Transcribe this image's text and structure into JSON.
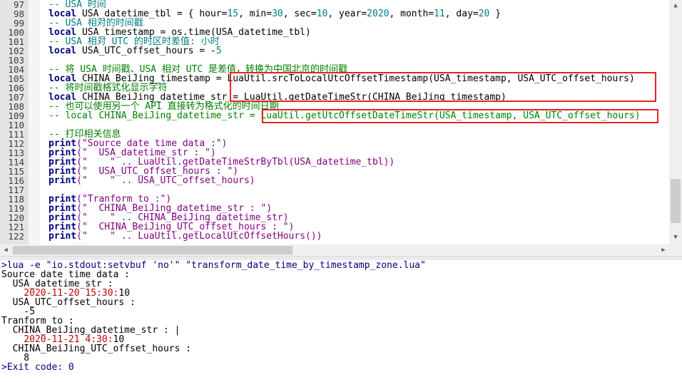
{
  "editor": {
    "lines": [
      {
        "n": "97"
      },
      {
        "n": "98"
      },
      {
        "n": "99"
      },
      {
        "n": "100"
      },
      {
        "n": "101"
      },
      {
        "n": "102"
      },
      {
        "n": "103"
      },
      {
        "n": "104"
      },
      {
        "n": "105"
      },
      {
        "n": "106"
      },
      {
        "n": "107"
      },
      {
        "n": "108"
      },
      {
        "n": "109"
      },
      {
        "n": "110"
      },
      {
        "n": "111"
      },
      {
        "n": "112"
      },
      {
        "n": "113"
      },
      {
        "n": "114"
      },
      {
        "n": "115"
      },
      {
        "n": "116"
      },
      {
        "n": "117"
      },
      {
        "n": "118"
      },
      {
        "n": "119"
      },
      {
        "n": "120"
      },
      {
        "n": "121"
      },
      {
        "n": "122"
      }
    ],
    "code": {
      "l97": "-- USA 时间",
      "l98_kw": "local",
      "l98_a": " USA_datetime_tbl = { hour=",
      "l98_n1": "15",
      "l98_b": ", min=",
      "l98_n2": "30",
      "l98_c": ", sec=",
      "l98_n3": "10",
      "l98_d": ", year=",
      "l98_n4": "2020",
      "l98_e": ", month=",
      "l98_n5": "11",
      "l98_f": ", day=",
      "l98_n6": "20",
      "l98_g": " }",
      "l99": "-- USA 相对的时间戳",
      "l100_kw": "local",
      "l100_a": " USA_timestamp = os.time(USA_datetime_tbl)",
      "l101": "-- USA 相对 UTC 的时区时差值: 小时",
      "l102_kw": "local",
      "l102_a": " USA_UTC_offset_hours = -",
      "l102_n": "5",
      "l104": "-- 将 USA 时间戳、USA 相对 UTC 是差值，转换为中国北京的时间戳",
      "l105_kw": "local",
      "l105_a": " CHINA_BeiJing_timestamp = LuaUtil.srcToLocalUtcOffsetTimestamp(USA_timestamp, USA_UTC_offset_hours)",
      "l106": "-- 将时间戳格式化显示字符",
      "l107_kw": "local",
      "l107_a": " CHINA_BeiJing_datetime_str = LuaUtil.getDateTimeStr(CHINA_BeiJing_timestamp)",
      "l108": "-- 也可以使用另一个 API 直接转为格式化的时间日期",
      "l109": "-- local CHINA_BeiJing_datetime_str = LuaUtil.getUtcOffsetDateTimeStr(USA_timestamp, USA_UTC_offset_hours)",
      "l111": "-- 打印相关信息",
      "print": "print",
      "l112_s": "(\"Source date time data :\")",
      "l113_s": "(\"  USA_datetime_str : \")",
      "l114_s": "(\"    \" .. LuaUtil.getDateTimeStrByTbl(USA_datetime_tbl))",
      "l115_s": "(\"  USA_UTC_offset_hours : \")",
      "l116_s": "(\"    \" .. USA_UTC_offset_hours)",
      "l118_s": "(\"Tranform to :\")",
      "l119_s": "(\"  CHINA_BeiJing_datetime_str : \")",
      "l120_s": "(\"    \" .. CHINA_BeiJing_datetime_str)",
      "l121_s": "(\"  CHINA_BeiJing_UTC_offset_hours : \")",
      "l122_s": "(\"    \" .. LuaUtil.getLocalUtcOffsetHours())"
    }
  },
  "output": {
    "cmd": ">lua -e \"io.stdout:setvbuf 'no'\" \"transform_date_time_by_timestamp_zone.lua\"",
    "o1": "Source date time data :",
    "o2": "  USA_datetime_str :",
    "o3_red": "    2020-11-20 15:30:",
    "o3_tail": "10",
    "o4": "  USA_UTC_offset_hours :",
    "o5": "    -5",
    "o6": "Tranform to :",
    "o7": "  CHINA_BeiJing_datetime_str : |",
    "o8_red": "    2020-11-21 4:30:",
    "o8_tail": "10",
    "o9": "  CHINA_BeiJing_UTC_offset_hours :",
    "o10": "    8",
    "exit": ">Exit code: 0"
  },
  "colors": {
    "highlight": "#e8231d",
    "comment": "#007f7f",
    "keyword": "#00007f"
  },
  "icons": {
    "up": "chevron-up-icon",
    "down": "chevron-down-icon",
    "left": "chevron-left-icon",
    "right": "chevron-right-icon"
  }
}
